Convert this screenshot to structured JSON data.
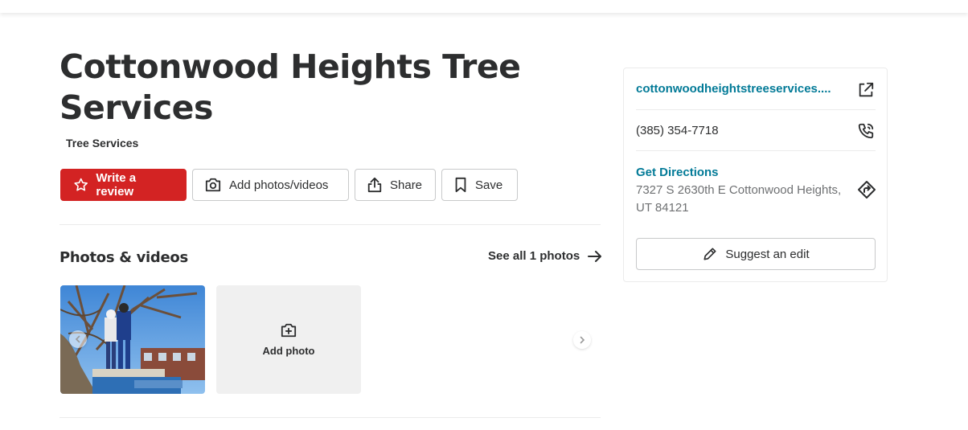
{
  "business": {
    "name": "Cottonwood Heights Tree Services",
    "category": "Tree Services"
  },
  "actions": {
    "write_review": "Write a review",
    "add_photos": "Add photos/videos",
    "share": "Share",
    "save": "Save"
  },
  "photos": {
    "section_title": "Photos & videos",
    "see_all": "See all 1 photos",
    "add_photo_label": "Add photo"
  },
  "sidebar": {
    "website": "cottonwoodheightstreeservices....",
    "phone": "(385) 354-7718",
    "directions_label": "Get Directions",
    "address": "7327 S 2630th E Cottonwood Heights, UT 84121",
    "suggest_edit": "Suggest an edit"
  },
  "icons": {
    "review": "star-icon",
    "photos": "camera-icon",
    "share": "share-icon",
    "save": "bookmark-icon",
    "see_all": "arrow-right-icon",
    "add_photo": "camera-plus-icon",
    "website": "external-link-icon",
    "phone": "phone-icon",
    "directions": "directions-icon",
    "suggest": "pencil-icon"
  },
  "colors": {
    "primary_red": "#d32323",
    "link_teal": "#027a97",
    "text_dark": "#2d2e2f",
    "text_muted": "#6e7072"
  }
}
